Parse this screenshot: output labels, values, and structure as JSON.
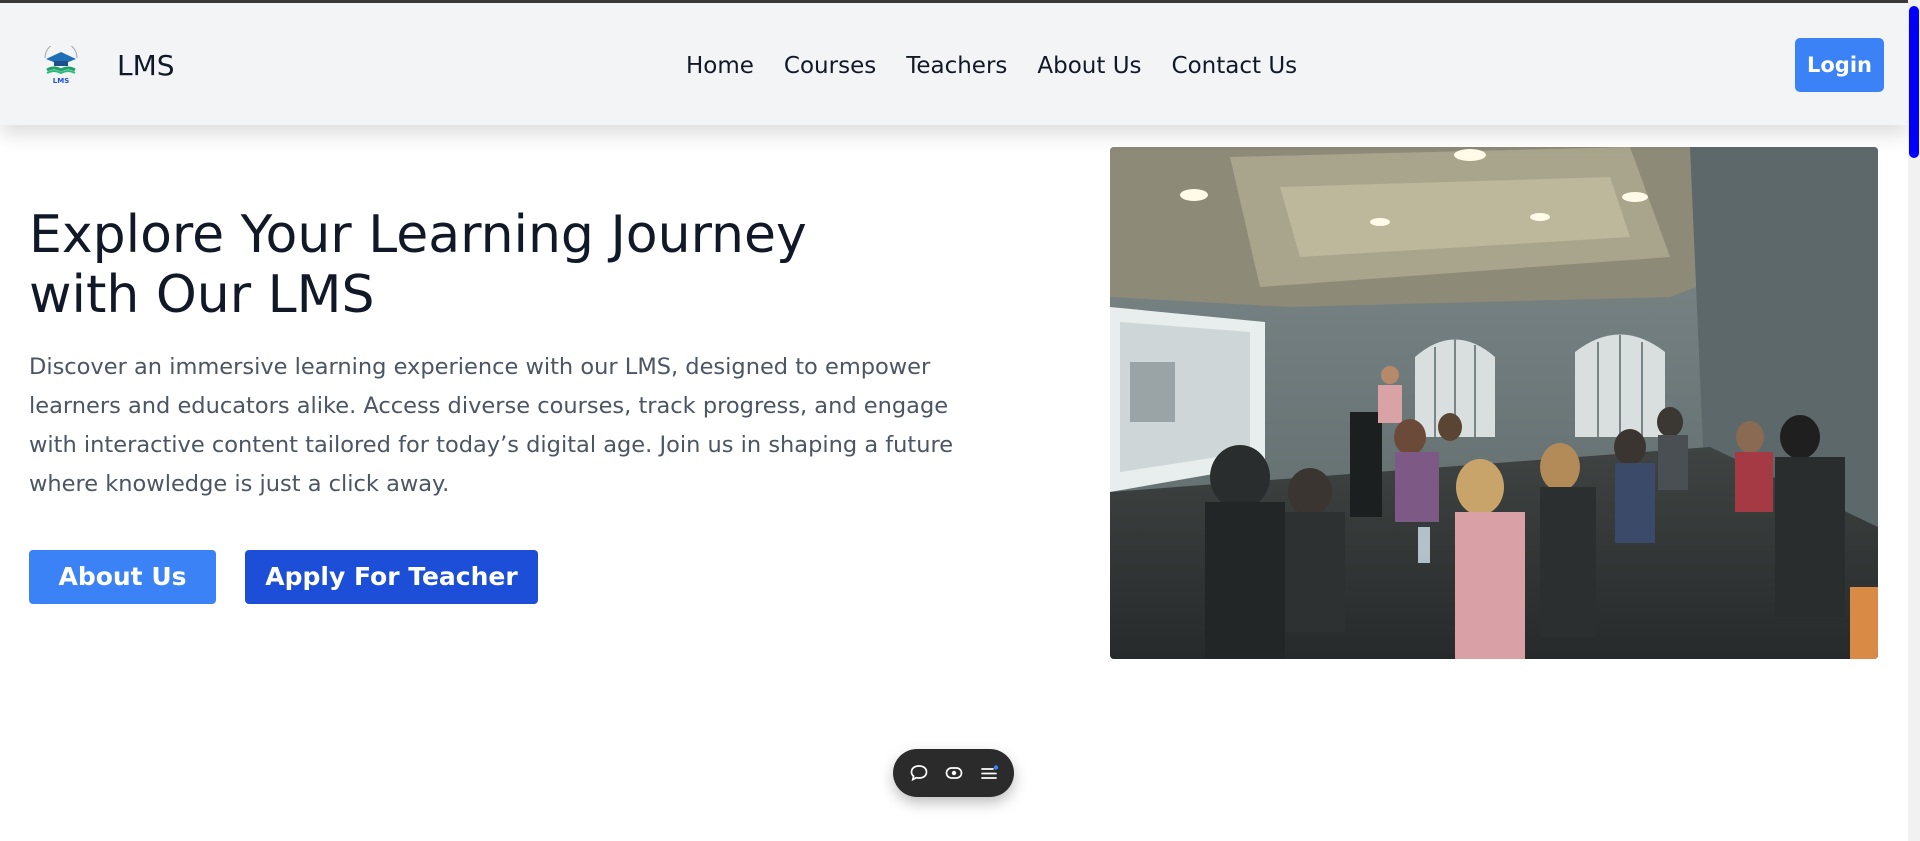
{
  "header": {
    "brand": "LMS",
    "logo_text": "LMS",
    "nav": [
      {
        "label": "Home"
      },
      {
        "label": "Courses"
      },
      {
        "label": "Teachers"
      },
      {
        "label": "About Us"
      },
      {
        "label": "Contact Us"
      }
    ],
    "login_label": "Login"
  },
  "hero": {
    "title_line1": "Explore Your Learning Journey",
    "title_line2": "with Our LMS",
    "description": "Discover an immersive learning experience with our LMS, designed to empower learners and educators alike. Access diverse courses, track progress, and engage with interactive content tailored for today’s digital age. Join us in shaping a future where knowledge is just a click away.",
    "about_button": "About Us",
    "apply_button": "Apply For Teacher"
  },
  "toolbar": {
    "icons": [
      "chat-icon",
      "eye-icon",
      "menu-icon"
    ]
  },
  "colors": {
    "primary": "#3b82f6",
    "primary_dark": "#1d4ed8",
    "navbar_bg": "#f3f4f6",
    "text_dark": "#111827",
    "text_muted": "#4b5563",
    "scroll_thumb": "#0000ff"
  }
}
